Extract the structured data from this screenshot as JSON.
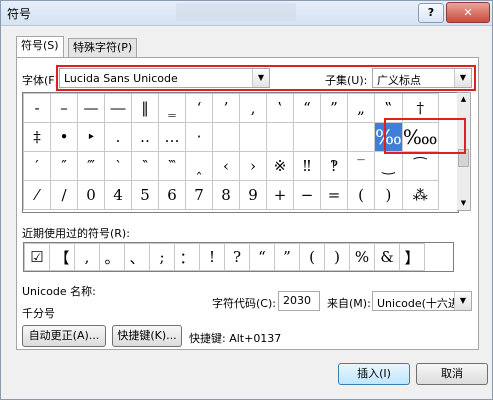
{
  "window": {
    "title": "符号",
    "help": "?",
    "close": "✕"
  },
  "tabs": [
    {
      "label": "符号(S)"
    },
    {
      "label": "特殊字符(P)"
    }
  ],
  "font": {
    "label": "字体(F):",
    "value": "Lucida Sans Unicode"
  },
  "subset": {
    "label": "子集(U):",
    "value": "广义标点"
  },
  "grid": {
    "rows": [
      [
        "-",
        "–",
        "—",
        "―",
        "‖",
        "‗",
        "‘",
        "’",
        "‚",
        "‛",
        "“",
        "”",
        "„",
        "‟",
        "†"
      ],
      [
        "‡",
        "•",
        "‣",
        "․",
        "‥",
        "…",
        "‧",
        "",
        "",
        "",
        "",
        "",
        "",
        "‰",
        "‱"
      ],
      [
        "′",
        "″",
        "‴",
        "‵",
        "‶",
        "‷",
        "‸",
        "‹",
        "›",
        "※",
        "‼",
        "‽",
        "‾",
        "‿",
        "⁀"
      ],
      [
        "⁄",
        "/",
        "0",
        "4",
        "5",
        "6",
        "7",
        "8",
        "9",
        "+",
        "−",
        "=",
        "(",
        ")",
        "⁂"
      ]
    ]
  },
  "recent": {
    "label": "近期使用过的符号(R):",
    "symbols": [
      "☑",
      "【",
      ",",
      "。",
      "、",
      ";",
      "：",
      "!",
      "?",
      "“",
      "”",
      "(",
      ")",
      "%",
      "&",
      "】"
    ]
  },
  "unicode": {
    "name_label": "Unicode 名称:",
    "char_name": "千分号"
  },
  "charcode": {
    "label": "字符代码(C):",
    "value": "2030"
  },
  "from": {
    "label": "来自(M):",
    "value": "Unicode(十六进"
  },
  "buttons": {
    "autocorrect": "自动更正(A)...",
    "shortcut": "快捷键(K)...",
    "insert": "插入(I)",
    "cancel": "取消"
  },
  "shortcut_info": "快捷键: Alt+0137",
  "colors": {
    "highlight": "#e02020",
    "selected": "#3f7fd9"
  }
}
